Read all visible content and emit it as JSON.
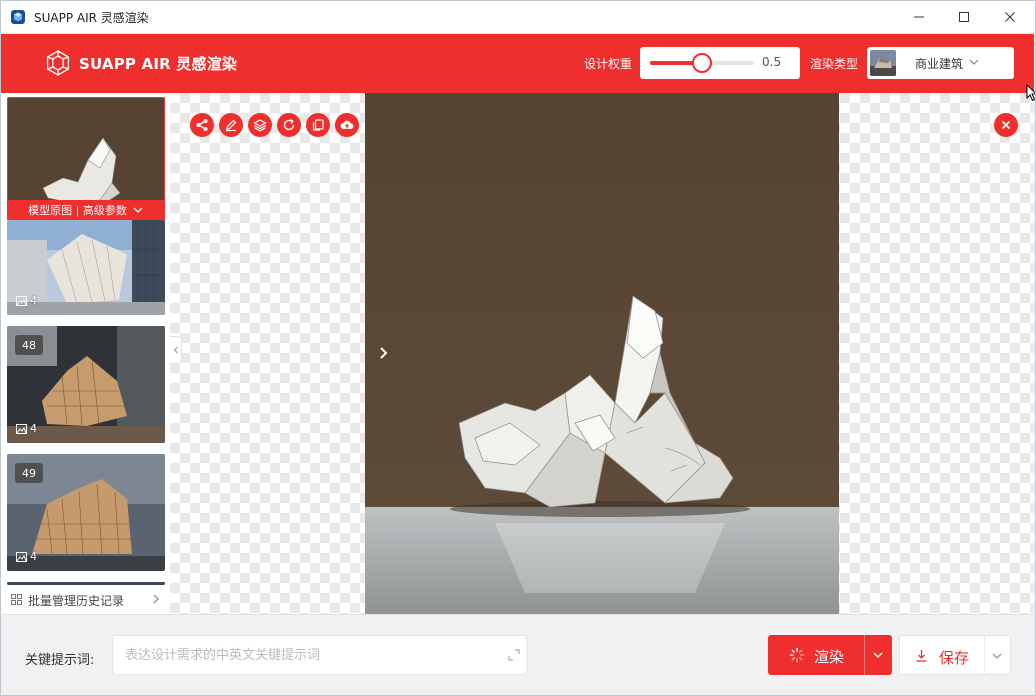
{
  "window": {
    "title": "SUAPP AIR 灵感渲染",
    "icon": "app-cube-icon",
    "controls": [
      "minimize-icon",
      "maximize-icon",
      "close-icon"
    ]
  },
  "header": {
    "brand": "SUAPP AIR 灵感渲染",
    "design_weight_label": "设计权重",
    "design_weight_value": "0.5",
    "design_weight_fraction": 0.5,
    "render_type_label": "渲染类型",
    "render_type_value": "商业建筑"
  },
  "sidebar": {
    "selected_label": "模型原图 | 高级参数",
    "history": [
      {
        "number": "",
        "count": "4"
      },
      {
        "number": "48",
        "count": "4"
      },
      {
        "number": "49",
        "count": "4"
      }
    ],
    "batch_label": "批量管理历史记录"
  },
  "toolbar": {
    "icons": [
      "share-icon",
      "edit-icon",
      "layers-icon",
      "refresh-icon",
      "copy-icon",
      "cloud-upload-icon"
    ],
    "close_icon": "close-icon"
  },
  "bottom": {
    "keyword_label": "关键提示词:",
    "keyword_placeholder": "表达设计需求的中英文关键提示词",
    "keyword_value": "",
    "render_label": "渲染",
    "save_label": "保存"
  },
  "colors": {
    "accent": "#ee2f2e",
    "canvas_bg": "#5a4535"
  }
}
